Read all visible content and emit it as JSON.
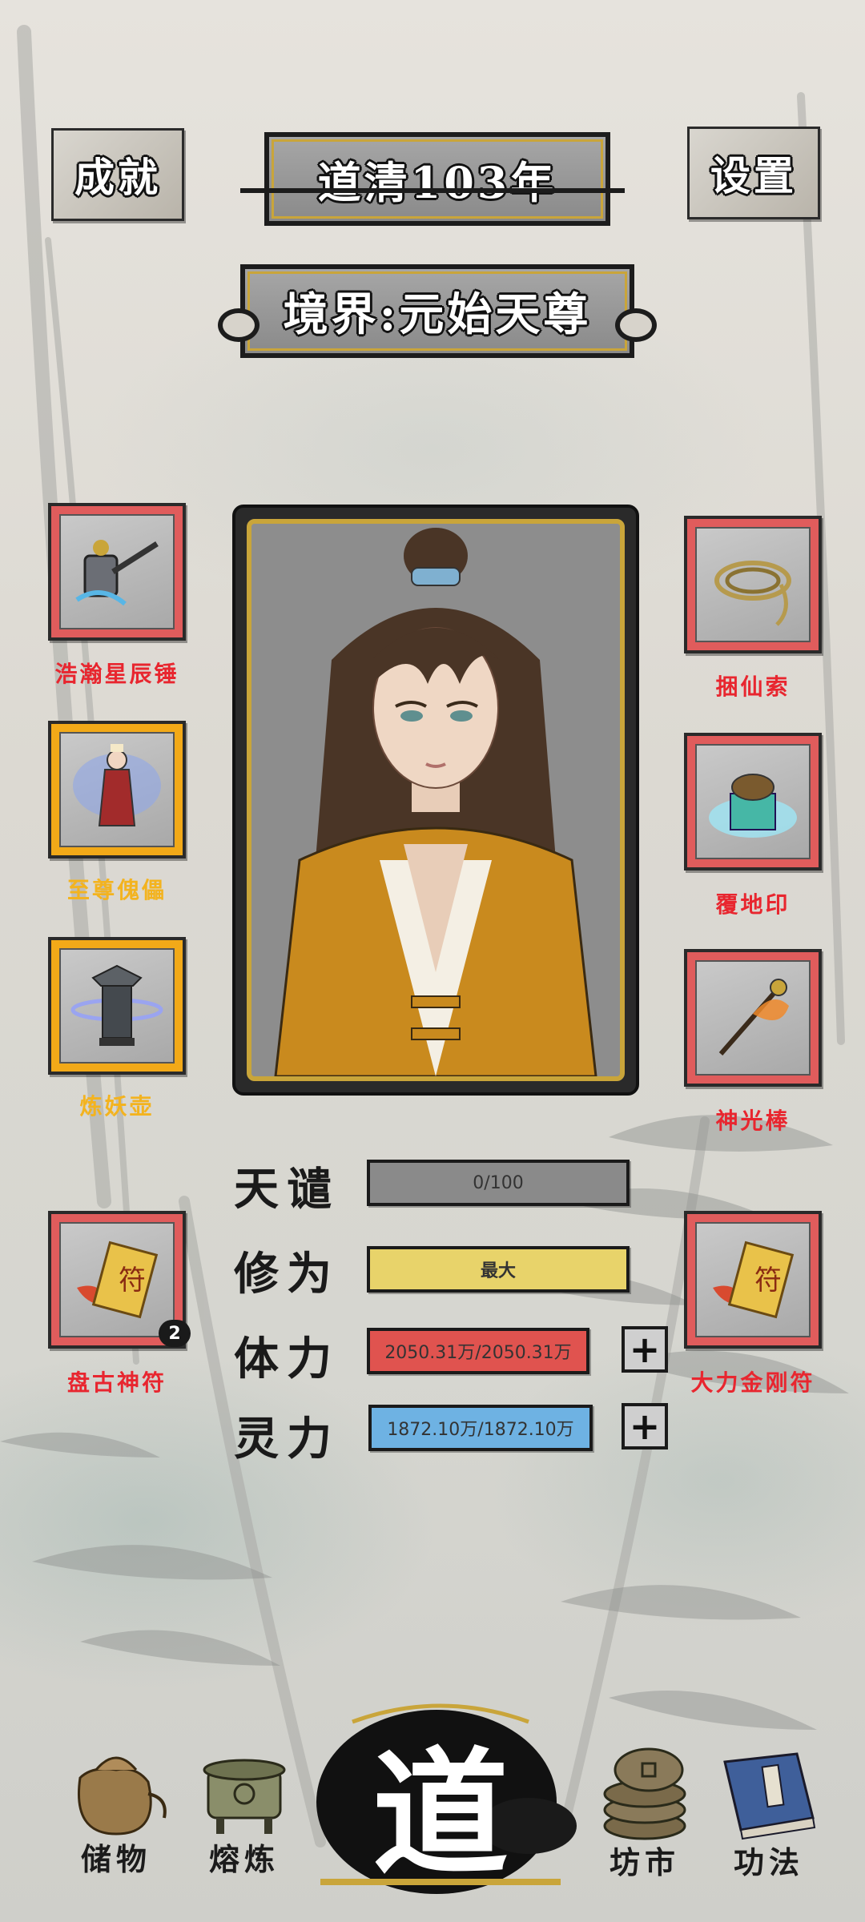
{
  "header": {
    "achievements_label": "成就",
    "settings_label": "设置",
    "year_title": "道清103年",
    "realm_title": "境界:元始天尊"
  },
  "left_slots": [
    {
      "label": "浩瀚星辰锤",
      "rarity": "red",
      "icon": "hammer-icon"
    },
    {
      "label": "至尊傀儡",
      "rarity": "gold",
      "icon": "puppet-icon"
    },
    {
      "label": "炼妖壶",
      "rarity": "gold",
      "icon": "pot-icon"
    },
    {
      "label": "盘古神符",
      "rarity": "red",
      "icon": "talisman-icon",
      "count": "2"
    }
  ],
  "right_slots": [
    {
      "label": "捆仙索",
      "rarity": "red",
      "icon": "rope-icon"
    },
    {
      "label": "覆地印",
      "rarity": "red",
      "icon": "seal-icon"
    },
    {
      "label": "神光棒",
      "rarity": "red",
      "icon": "staff-icon"
    },
    {
      "label": "大力金刚符",
      "rarity": "red",
      "icon": "talisman-icon"
    }
  ],
  "stats": {
    "tribulation": {
      "label": "天谴",
      "value": "0/100"
    },
    "cultivation": {
      "label": "修为",
      "value": "最大"
    },
    "stamina": {
      "label": "体力",
      "value": "2050.31万/2050.31万"
    },
    "spirit": {
      "label": "灵力",
      "value": "1872.10万/1872.10万"
    }
  },
  "nav": {
    "storage": "储物",
    "smelting": "熔炼",
    "center": "道",
    "market": "坊市",
    "skills": "功法"
  },
  "colors": {
    "red_frame": "#e05c5c",
    "gold_frame": "#f2a918",
    "red_label": "#e8262f",
    "gold_label": "#f3b31f",
    "tribulation_bar": "#8a8a8a",
    "cultivation_bar": "#e8d36a",
    "stamina_bar": "#e0534f",
    "spirit_bar": "#6eb2e3"
  }
}
